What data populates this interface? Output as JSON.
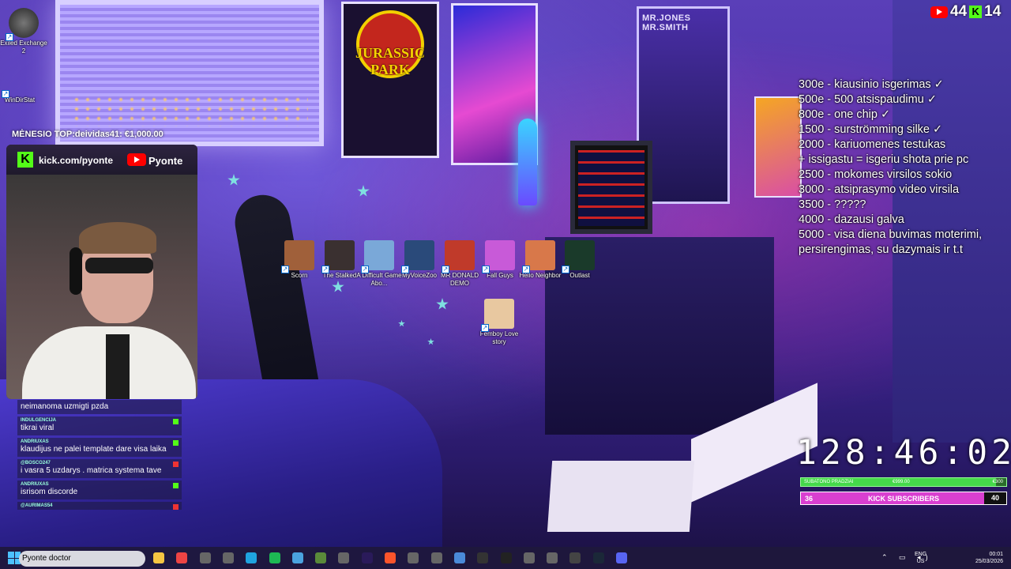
{
  "desktop_top_left_icons": [
    {
      "label": "Exiled Exchange 2"
    },
    {
      "label": "WinDirStat"
    }
  ],
  "scene": {
    "poster_title": "JURASSIC PARK",
    "poster_mib": "MR.JONES MR.SMITH"
  },
  "desktop_icons": [
    {
      "label": "Scorn",
      "color": "#a0603a"
    },
    {
      "label": "The Stalked",
      "color": "#3a3030"
    },
    {
      "label": "A Difficult Game Abo...",
      "color": "#7aa8d8"
    },
    {
      "label": "MyVoiceZoo",
      "color": "#2a4a7a"
    },
    {
      "label": "MR DONALD DEMO",
      "color": "#c03a2a"
    },
    {
      "label": "Fall Guys",
      "color": "#c85ad8"
    },
    {
      "label": "Hello Neighbor",
      "color": "#d8784a"
    },
    {
      "label": "Outlast",
      "color": "#1a3a2a"
    },
    {
      "label": "Femboy Love story",
      "color": "#e8c8a0"
    }
  ],
  "overlay": {
    "top_donor": "MĖNESIO TOP:deividas41: €1,000.00",
    "kick_url": "kick.com/pyonte",
    "youtube_name": "Pyonte",
    "counter": {
      "youtube": "44",
      "kick": "14"
    }
  },
  "chat": [
    {
      "user": "",
      "text": "neimanoma uzmigti pzda",
      "badge": "none"
    },
    {
      "user": "INDULGENCIJA",
      "text": "tikrai viral",
      "badge": "green"
    },
    {
      "user": "ANDRIUXAS",
      "text": "klaudijus ne palei template dare visa laika",
      "badge": "green"
    },
    {
      "user": "@BOSCO247",
      "text": "i vasra 5 uzdarys . matrica systema tave",
      "badge": "red"
    },
    {
      "user": "ANDRIUXAS",
      "text": "isrisom discorde",
      "badge": "green"
    },
    {
      "user": "@AURIMAS54",
      "text": "",
      "badge": "red"
    }
  ],
  "goals": [
    "300e - kiausinio isgerimas ✓",
    "500e - 500 atsispaudimu ✓",
    "800e - one chip ✓",
    "1500 - surströmming silke ✓",
    "2000 - kariuomenes testukas",
    "+ issigastu = isgeriu shota prie pc",
    "2500 - mokomes virsilos sokio",
    "3000 - atsiprasymo video virsila",
    "3500 - ?????",
    "4000 - dazausi galva",
    "5000 - visa diena buvimas moterimi,",
    "persirengimas, su dazymais ir t.t"
  ],
  "timer": "128:46:02",
  "subathon": {
    "label": "SUBATONO PRADZIAI",
    "amount": "€999.00",
    "goal": "€300",
    "progress": 0.95
  },
  "kick_subs": {
    "current": "36",
    "label": "KICK SUBSCRIBERS",
    "target": "40",
    "progress": 0.9
  },
  "taskbar": {
    "search_text": "Pyonte doctor",
    "lang_line1": "ENG",
    "lang_line2": "US",
    "time": "00:01",
    "date": "25/03/2026",
    "apps": [
      "file-explorer",
      "chrome",
      "app",
      "app",
      "edge",
      "spotify",
      "photos",
      "minecraft",
      "app",
      "premiere",
      "brave",
      "app",
      "app",
      "notes",
      "obs",
      "terminal",
      "app",
      "app",
      "tf",
      "steam",
      "discord"
    ]
  }
}
